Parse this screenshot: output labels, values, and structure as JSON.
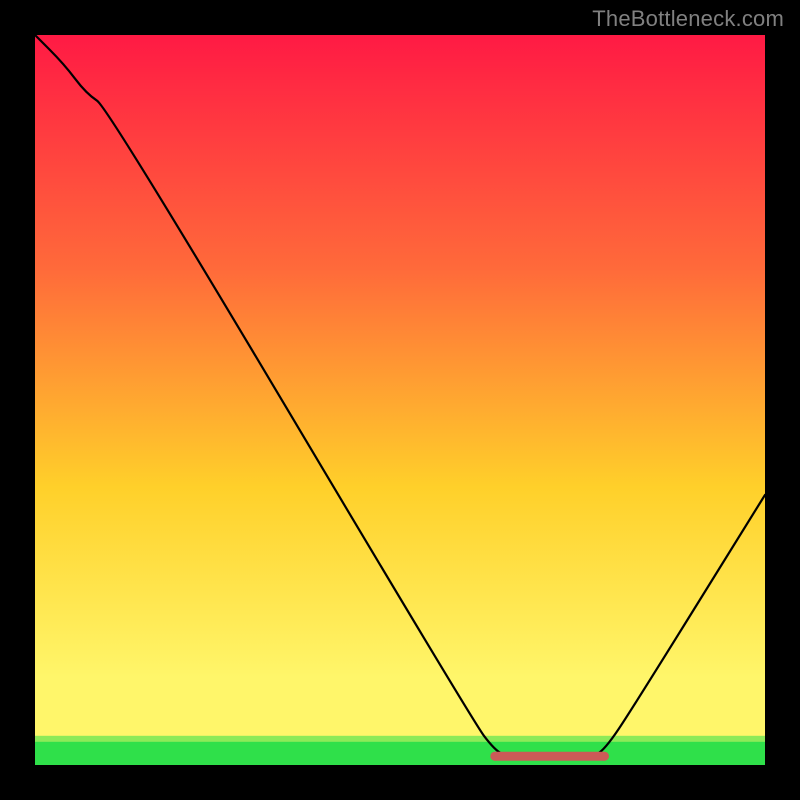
{
  "watermark": "TheBottleneck.com",
  "colors": {
    "black": "#000000",
    "curve": "#000000",
    "flat_segment": "#cc5a57",
    "grad_top": "#ff1a44",
    "grad_mid_upper": "#ff6a3a",
    "grad_mid": "#ffd02a",
    "grad_mid_lower": "#fff66a",
    "grad_bottom": "#2fe04a"
  },
  "chart_data": {
    "type": "line",
    "x_range": [
      0,
      100
    ],
    "y_range": [
      0,
      100
    ],
    "xlabel": "",
    "ylabel": "",
    "title": "",
    "curve": [
      {
        "x": 0,
        "y": 100
      },
      {
        "x": 4,
        "y": 96
      },
      {
        "x": 7,
        "y": 92
      },
      {
        "x": 10,
        "y": 90
      },
      {
        "x": 60,
        "y": 6
      },
      {
        "x": 63,
        "y": 2
      },
      {
        "x": 65,
        "y": 1
      },
      {
        "x": 76,
        "y": 1
      },
      {
        "x": 78,
        "y": 2
      },
      {
        "x": 82,
        "y": 8
      },
      {
        "x": 100,
        "y": 37
      }
    ],
    "flat_segment": {
      "x_start": 63,
      "x_end": 78,
      "y": 1.2
    },
    "green_band_top_y": 4
  }
}
